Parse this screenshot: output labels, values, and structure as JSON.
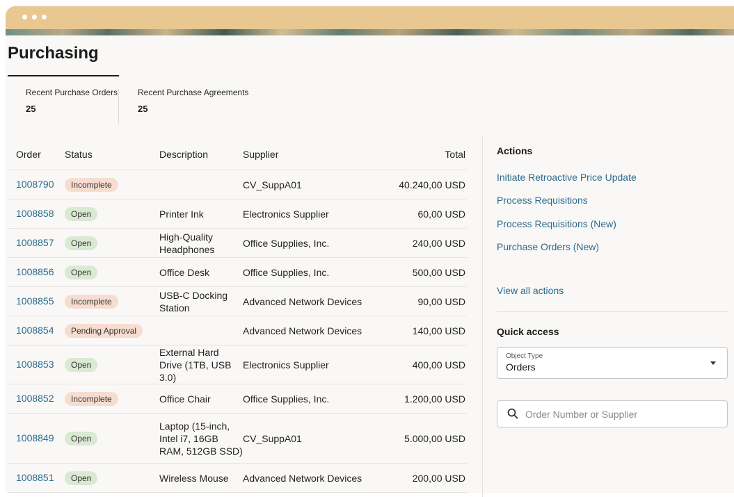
{
  "page": {
    "title": "Purchasing"
  },
  "metrics": [
    {
      "label": "Recent Purchase Orders",
      "value": "25"
    },
    {
      "label": "Recent Purchase Agreements",
      "value": "25"
    }
  ],
  "table": {
    "headers": {
      "order": "Order",
      "status": "Status",
      "description": "Description",
      "supplier": "Supplier",
      "total": "Total"
    },
    "rows": [
      {
        "order": "1008790",
        "status": "Incomplete",
        "status_kind": "incomplete",
        "description": "",
        "supplier": "CV_SuppA01",
        "total": "40.240,00 USD"
      },
      {
        "order": "1008858",
        "status": "Open",
        "status_kind": "open",
        "description": "Printer Ink",
        "supplier": "Electronics Supplier",
        "total": "60,00 USD"
      },
      {
        "order": "1008857",
        "status": "Open",
        "status_kind": "open",
        "description": "High-Quality Headphones",
        "supplier": "Office Supplies, Inc.",
        "total": "240,00 USD"
      },
      {
        "order": "1008856",
        "status": "Open",
        "status_kind": "open",
        "description": "Office Desk",
        "supplier": "Office Supplies, Inc.",
        "total": "500,00 USD"
      },
      {
        "order": "1008855",
        "status": "Incomplete",
        "status_kind": "incomplete",
        "description": "USB-C Docking Station",
        "supplier": "Advanced Network Devices",
        "total": "90,00 USD"
      },
      {
        "order": "1008854",
        "status": "Pending Approval",
        "status_kind": "pending",
        "description": "",
        "supplier": "Advanced Network Devices",
        "total": "140,00 USD"
      },
      {
        "order": "1008853",
        "status": "Open",
        "status_kind": "open",
        "description": "External Hard Drive (1TB, USB 3.0)",
        "supplier": "Electronics Supplier",
        "total": "400,00 USD"
      },
      {
        "order": "1008852",
        "status": "Incomplete",
        "status_kind": "incomplete",
        "description": "Office Chair",
        "supplier": "Office Supplies, Inc.",
        "total": "1.200,00 USD"
      },
      {
        "order": "1008849",
        "status": "Open",
        "status_kind": "open",
        "description": "Laptop (15-inch, Intel i7, 16GB RAM, 512GB SSD)",
        "supplier": "CV_SuppA01",
        "total": "5.000,00 USD"
      },
      {
        "order": "1008851",
        "status": "Open",
        "status_kind": "open",
        "description": "Wireless Mouse",
        "supplier": "Advanced Network Devices",
        "total": "200,00 USD"
      }
    ]
  },
  "actions": {
    "heading": "Actions",
    "items": [
      "Initiate Retroactive Price Update",
      "Process Requisitions",
      "Process Requisitions (New)",
      "Purchase Orders (New)"
    ],
    "view_all": "View all actions"
  },
  "quick_access": {
    "heading": "Quick access",
    "object_type_label": "Object Type",
    "object_type_value": "Orders",
    "search_placeholder": "Order Number or Supplier"
  },
  "colors": {
    "link": "#2b6a8e",
    "titlebar": "#e8c790",
    "badge_open": "#d9e9d2",
    "badge_incomplete": "#f7ddd0"
  },
  "icons": {
    "search": "search-icon",
    "dropdown": "caret-down-icon"
  }
}
